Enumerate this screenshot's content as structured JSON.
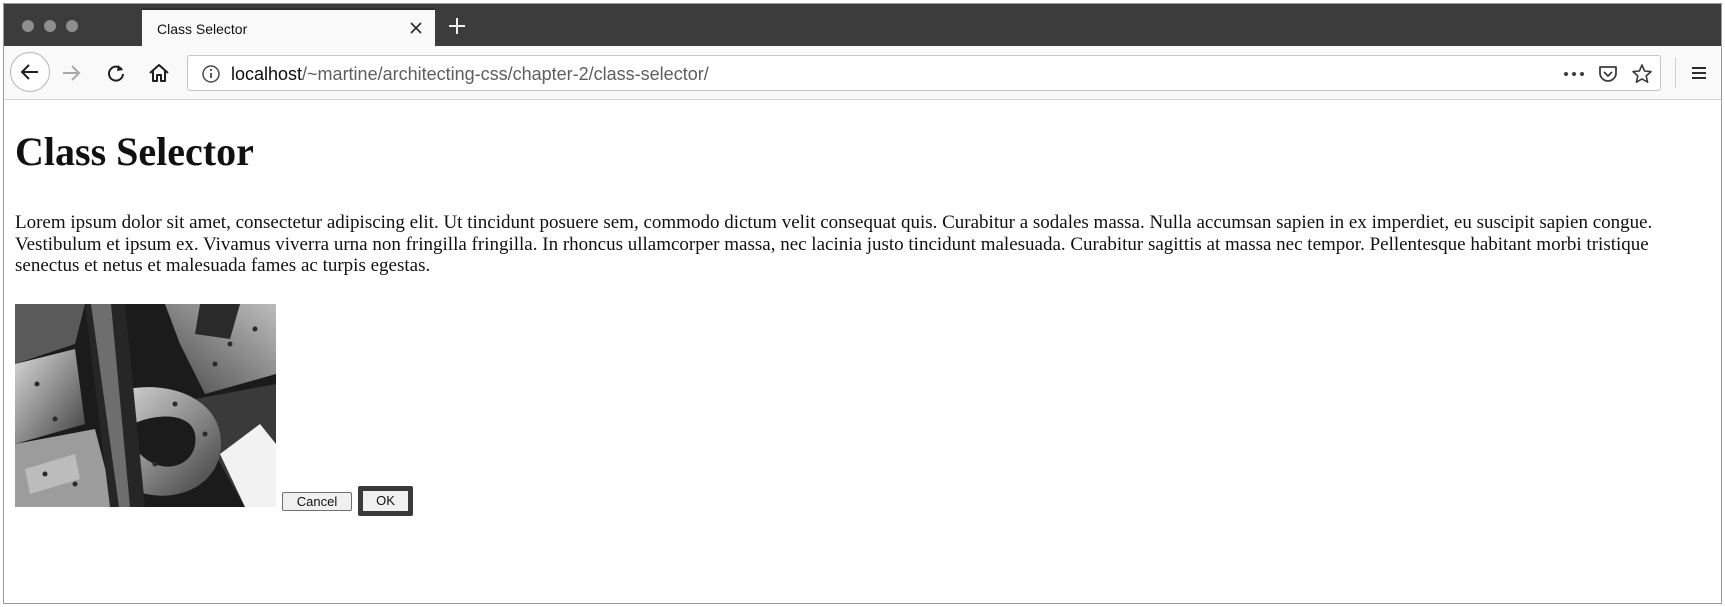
{
  "browser": {
    "tab_title": "Class Selector",
    "url_host": "localhost",
    "url_path": "/~martine/architecting-css/chapter-2/class-selector/"
  },
  "icons": {
    "close": "close-icon",
    "new_tab": "plus-icon",
    "back": "back-arrow-icon",
    "forward": "forward-arrow-icon",
    "reload": "reload-icon",
    "home": "home-icon",
    "info": "info-icon",
    "more": "more-icon",
    "pocket": "pocket-icon",
    "bookmark": "star-icon",
    "menu": "hamburger-menu-icon"
  },
  "page": {
    "heading": "Class Selector",
    "paragraph": "Lorem ipsum dolor sit amet, consectetur adipiscing elit. Ut tincidunt posuere sem, commodo dictum velit consequat quis. Curabitur a sodales massa. Nulla accumsan sapien in ex imperdiet, eu suscipit sapien congue. Vestibulum et ipsum ex. Vivamus viverra urna non fringilla fringilla. In rhoncus ullamcorper massa, nec lacinia justo tincidunt malesuada. Curabitur sagittis at massa nec tempor. Pellentesque habitant morbi tristique senectus et netus et malesuada fames ac turpis egestas.",
    "cancel_label": "Cancel",
    "ok_label": "OK"
  },
  "colors": {
    "tabstrip": "#3c3c3c",
    "toolbar": "#f9f9f9",
    "ok_border": "#3a3a3a"
  }
}
